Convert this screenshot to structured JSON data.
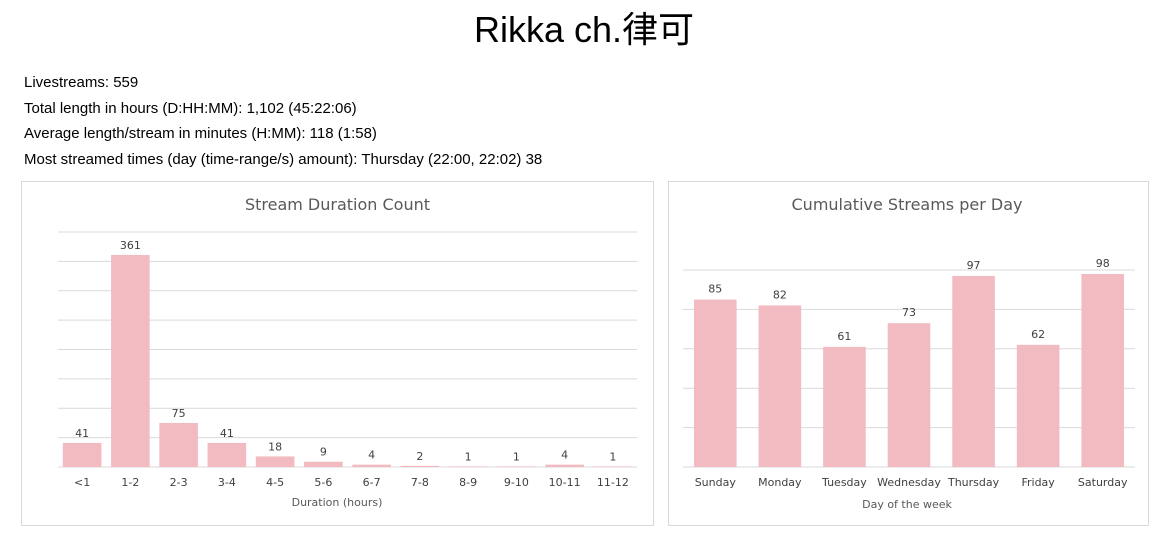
{
  "title": "Rikka ch.律可",
  "stats": [
    "Livestreams: 559",
    "Total length in hours (D:HH:MM): 1,102 (45:22:06)",
    "Average length/stream in minutes (H:MM): 118 (1:58)",
    "Most streamed times (day (time-range/s) amount): Thursday (22:00, 22:02) 38"
  ],
  "colors": {
    "bar": "#f2bbc1",
    "grid": "#d9d9d9",
    "text": "#404040"
  },
  "chart_data": [
    {
      "type": "bar",
      "title": "Stream Duration Count",
      "xlabel": "Duration (hours)",
      "ylabel": "",
      "categories": [
        "<1",
        "1-2",
        "2-3",
        "3-4",
        "4-5",
        "5-6",
        "6-7",
        "7-8",
        "8-9",
        "9-10",
        "10-11",
        "11-12"
      ],
      "values": [
        41,
        361,
        75,
        41,
        18,
        9,
        4,
        2,
        1,
        1,
        4,
        1
      ],
      "ylim": [
        0,
        400
      ],
      "grid": true,
      "legend": "none"
    },
    {
      "type": "bar",
      "title": "Cumulative Streams per Day",
      "xlabel": "Day of the week",
      "ylabel": "",
      "categories": [
        "Sunday",
        "Monday",
        "Tuesday",
        "Wednesday",
        "Thursday",
        "Friday",
        "Saturday"
      ],
      "values": [
        85,
        82,
        61,
        73,
        97,
        62,
        98
      ],
      "ylim": [
        0,
        100
      ],
      "grid": true,
      "legend": "none"
    }
  ]
}
